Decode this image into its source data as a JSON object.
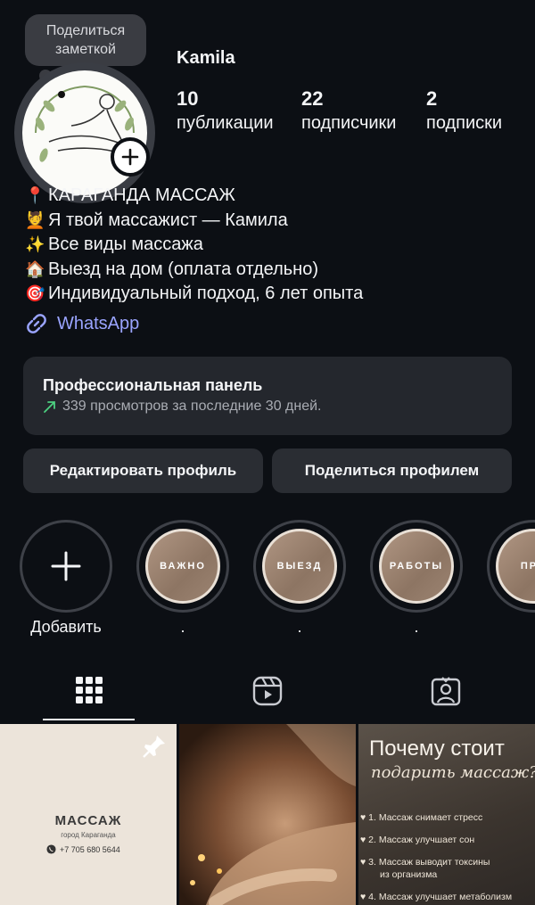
{
  "note": {
    "text": "Поделиться\nзаметкой"
  },
  "profile": {
    "username": "Kamila",
    "stats": [
      {
        "value": "10",
        "label": "публикации"
      },
      {
        "value": "22",
        "label": "подписчики"
      },
      {
        "value": "2",
        "label": "подписки"
      }
    ]
  },
  "bio": {
    "lines": [
      {
        "emoji": "📍",
        "text": "КАРАГАНДА МАССАЖ"
      },
      {
        "emoji": "💆",
        "text": "Я твой массажист — Камила"
      },
      {
        "emoji": "✨",
        "text": "Все виды массажа"
      },
      {
        "emoji": "🏠",
        "text": "Выезд на дом (оплата отдельно)"
      },
      {
        "emoji": "🎯",
        "text": "Индивидуальный подход, 6 лет опыта"
      }
    ],
    "link_label": "WhatsApp"
  },
  "pro_panel": {
    "title": "Профессиональная панель",
    "subtitle": "339 просмотров за последние 30 дней."
  },
  "actions": {
    "edit_label": "Редактировать профиль",
    "share_label": "Поделиться профилем"
  },
  "highlights": [
    {
      "cover": "",
      "label": "Добавить",
      "is_add": true
    },
    {
      "cover": "ВАЖНО",
      "label": "."
    },
    {
      "cover": "ВЫЕЗД",
      "label": "."
    },
    {
      "cover": "РАБОТЫ",
      "label": "."
    },
    {
      "cover": "ПРА",
      "label": ""
    }
  ],
  "tabs": [
    {
      "icon": "grid-icon",
      "active": true
    },
    {
      "icon": "reels-icon",
      "active": false
    },
    {
      "icon": "tagged-icon",
      "active": false
    }
  ],
  "posts": {
    "post1": {
      "title": "МАССАЖ",
      "city": "город Караганда",
      "phone": "+7 705 680 5644",
      "pinned": true
    },
    "post3": {
      "heading": "Почему стоит",
      "script": "подарить массаж?",
      "items": [
        "1. Массаж снимает стресс",
        "2. Массаж улучшает сон",
        "3. Массаж выводит токсины",
        "из организма",
        "4. Массаж улучшает метаболизм"
      ]
    }
  },
  "colors": {
    "background": "#0c0f14",
    "card": "#24272d",
    "link": "#9aa4ff",
    "growth": "#4cd080"
  }
}
